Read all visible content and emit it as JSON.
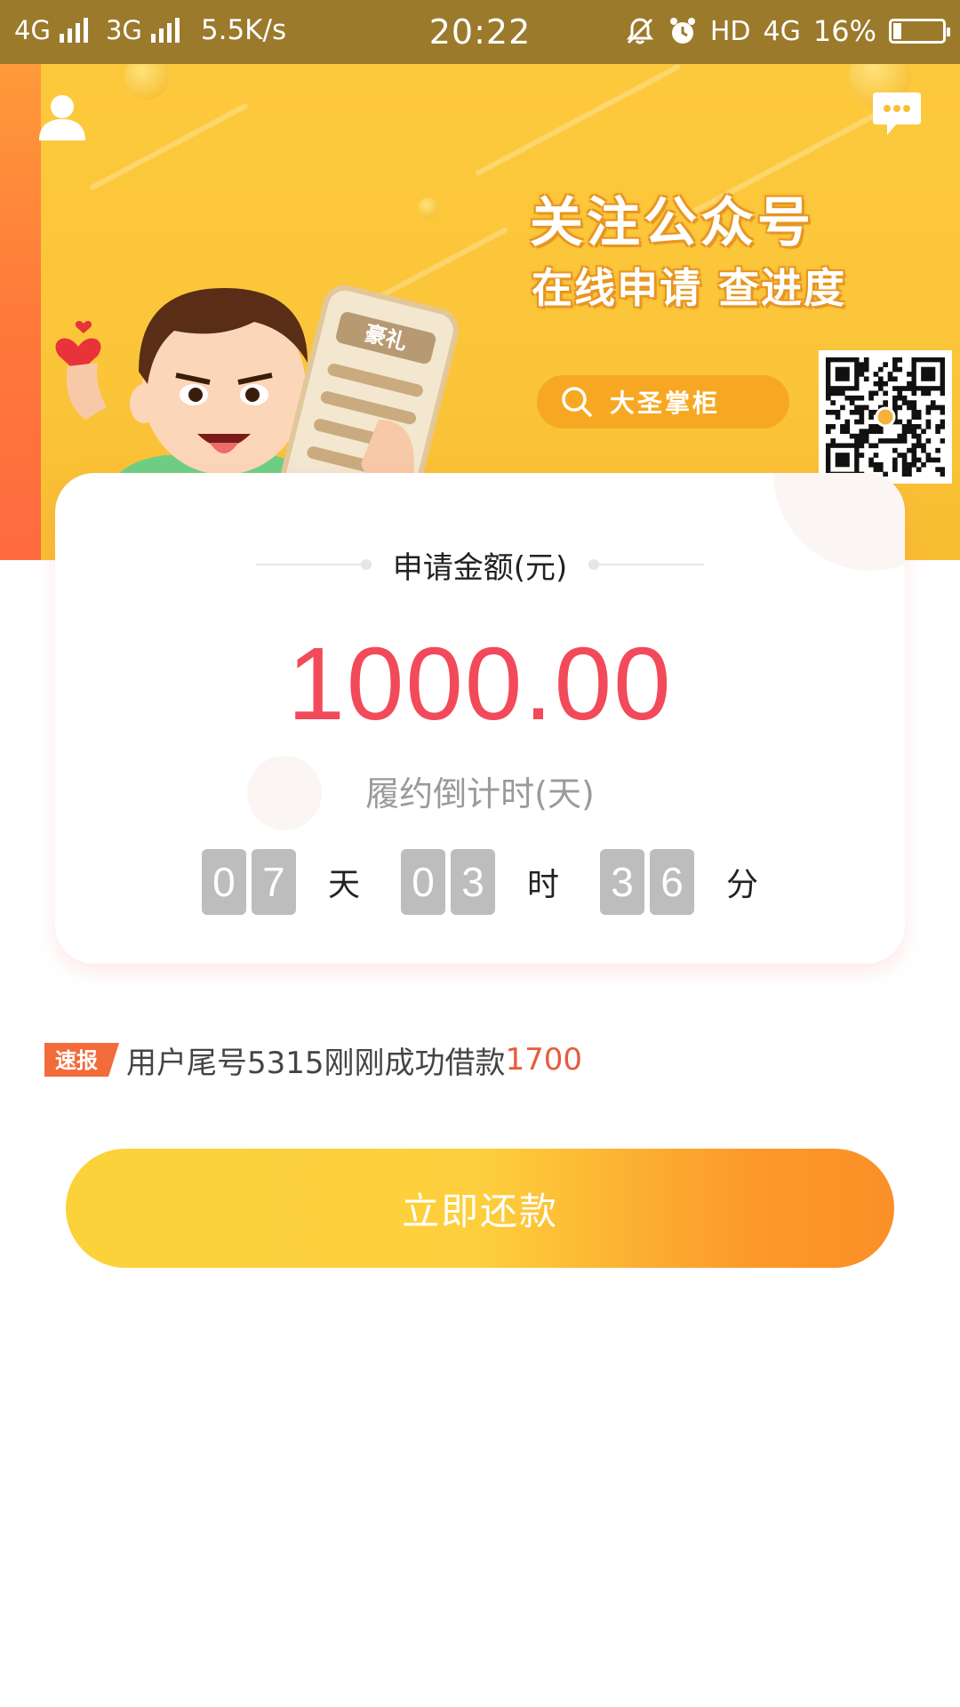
{
  "status_bar": {
    "network1": "4G",
    "network2": "3G",
    "speed": "5.5K/s",
    "time": "20:22",
    "hd": "HD",
    "network3": "4G",
    "battery_percent": "16%",
    "battery_level": 0.16,
    "background": "#9b7a2c"
  },
  "banner": {
    "headline_line1": "关注公众号",
    "headline_line2": "在线申请 查进度",
    "search_label": "大圣掌柜",
    "phone_tag": "豪礼",
    "background": "#fbc53a",
    "icons": [
      "user-icon",
      "message-icon",
      "search-icon",
      "qr-code",
      "mascot"
    ]
  },
  "card": {
    "amount_title": "申请金额(元)",
    "amount": "1000.00",
    "amount_color": "#f24a5a",
    "countdown_title": "履约倒计时(天)",
    "countdown": [
      {
        "digits": [
          "0",
          "7"
        ],
        "unit": "天"
      },
      {
        "digits": [
          "0",
          "3"
        ],
        "unit": "时"
      },
      {
        "digits": [
          "3",
          "6"
        ],
        "unit": "分"
      }
    ]
  },
  "ticker": {
    "badge": "速报",
    "text": "用户尾号5315刚刚成功借款",
    "amount": "1700",
    "amount_color": "#e85a3c"
  },
  "repay_button": {
    "label": "立即还款"
  }
}
